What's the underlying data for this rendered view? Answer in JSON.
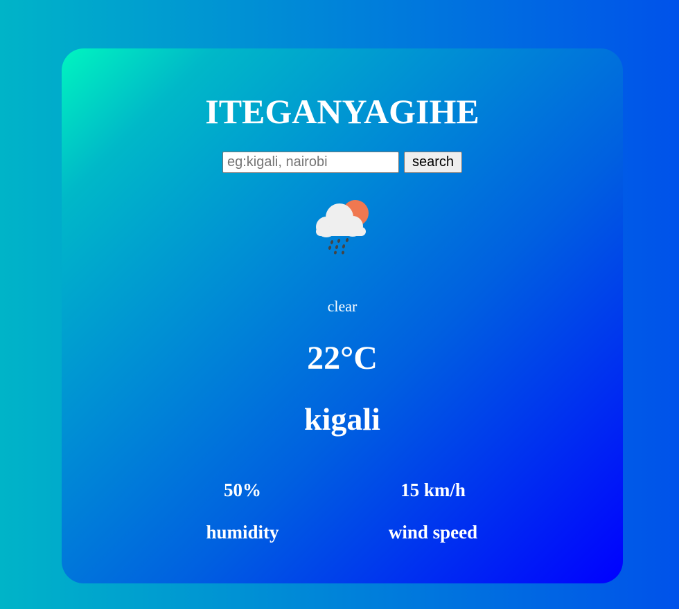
{
  "app": {
    "title": "ITEGANYAGIHE"
  },
  "search": {
    "placeholder": "eg:kigali, nairobi",
    "value": "",
    "button_label": "search"
  },
  "weather": {
    "icon": "rain-cloud-sun-icon",
    "condition": "clear",
    "temperature": "22°C",
    "city": "kigali"
  },
  "details": {
    "humidity_value": "50%",
    "humidity_label": "humidity",
    "wind_value": "15 km/h",
    "wind_label": "wind speed"
  },
  "colors": {
    "card_gradient_start": "#00f5c0",
    "card_gradient_end": "#0000ff",
    "page_background_start": "#00b4c8",
    "page_background_end": "#0052ea",
    "sun": "#f07850",
    "cloud": "#efefef",
    "rain": "#444444"
  }
}
